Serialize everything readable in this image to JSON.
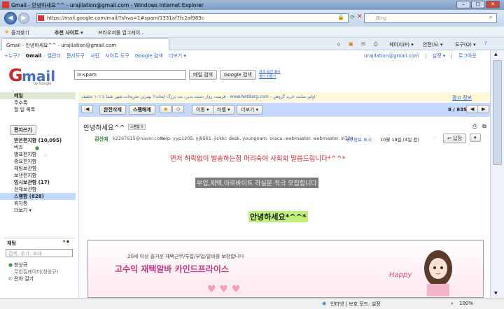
{
  "window": {
    "title": "Gmail - 안녕하세요^^ - urajilation@gmail.com - Windows Internet Explorer"
  },
  "address": {
    "url": "https://mail.google.com/mail/?shva=1#spam/1331af7fc2af983c",
    "search_placeholder": "Bing"
  },
  "favorites": {
    "label": "즐겨찾기",
    "items": [
      "추천 사이트 ▾",
      "브라우저를 업그레이..."
    ]
  },
  "tab": {
    "label": "Gmail - 안녕하세요^^ - urajilation@gmail.com"
  },
  "ie_tools": [
    "페이지(P) ▾",
    "안전(S) ▾",
    "도구(O) ▾"
  ],
  "gbar": {
    "links": [
      "+누구?",
      "Gmail",
      "캘린더",
      "문서도구",
      "사진",
      "사이트 도구",
      "Google 검색",
      "더보기 ▾"
    ],
    "account": "urajilation@gmail.com",
    "account_links": [
      "|",
      "설정 ▾",
      "|",
      "로그아웃"
    ]
  },
  "search": {
    "value": "in:spam",
    "mail_search": "메일 검색",
    "google_search": "Google 검색",
    "opt1": "검색 옵션 표시",
    "opt2": "필터 만들기"
  },
  "ad": {
    "text": "فرصت رواز دست ندين. نت بزرگ ايجاندا! بهترين تخريحات شهر شما با ٪١٠ تخفيف - www.NetBarg.com - اوليز سايت خريد گروهي",
    "link": "광고 정보"
  },
  "compose": "편지쓰기",
  "sidebar": {
    "top": [
      "메일",
      "주소록",
      "할 일 목록"
    ],
    "labels": [
      "받은편지함 (10,095)",
      "버즈",
      "별표편지함",
      "중요편지함",
      "채팅보관함",
      "보낸편지함",
      "임시보관함 (17)",
      "전체보관함",
      "스팸함 (828)",
      "휴지통",
      "더보기 ▾"
    ],
    "chat_title": "채팅",
    "chat_placeholder": "검색, 추가, 초대",
    "contacts": [
      "창상규",
      "무한질레이터(창상규)",
      "전화 걸기"
    ]
  },
  "toolbar": {
    "back": "◀",
    "not_spam": "완전삭제",
    "delete_forever": "스팸해제",
    "move": "이동 ▾",
    "label": "라벨 ▾",
    "more": "더보기 ▾",
    "count": "8 / 835"
  },
  "message": {
    "subject": "안녕하세요^^",
    "tag": "스팸함 X",
    "sender": "김선애",
    "sender_email": "k2267615@naver.com",
    "recipients": "help. yyp1205. yj9561. jickkr. desk. youngnam. oraca. webmaster. webmaster. si724",
    "details": "세부정보 표시",
    "date": "10월 19일 (4일 전)",
    "reply": "답장",
    "line1": "먼저 허락없이 발송하는점 머리숙여 사죄의 말씀드립니다*^^*",
    "line2": "부업,재택,아르바이트 하실분 적극 모집합니다",
    "line3": "안녕하세요*^^*",
    "banner_line1": "20세 이상 즐거운 재택근무/투잡/부업/알바를 보장합니다",
    "banner_line2": "고수익 재택알바 카인드프라이스",
    "banner_happy": "Happy"
  },
  "status": {
    "zone": "인터넷 | 보호 모드: 설정",
    "zoom": "100%"
  }
}
